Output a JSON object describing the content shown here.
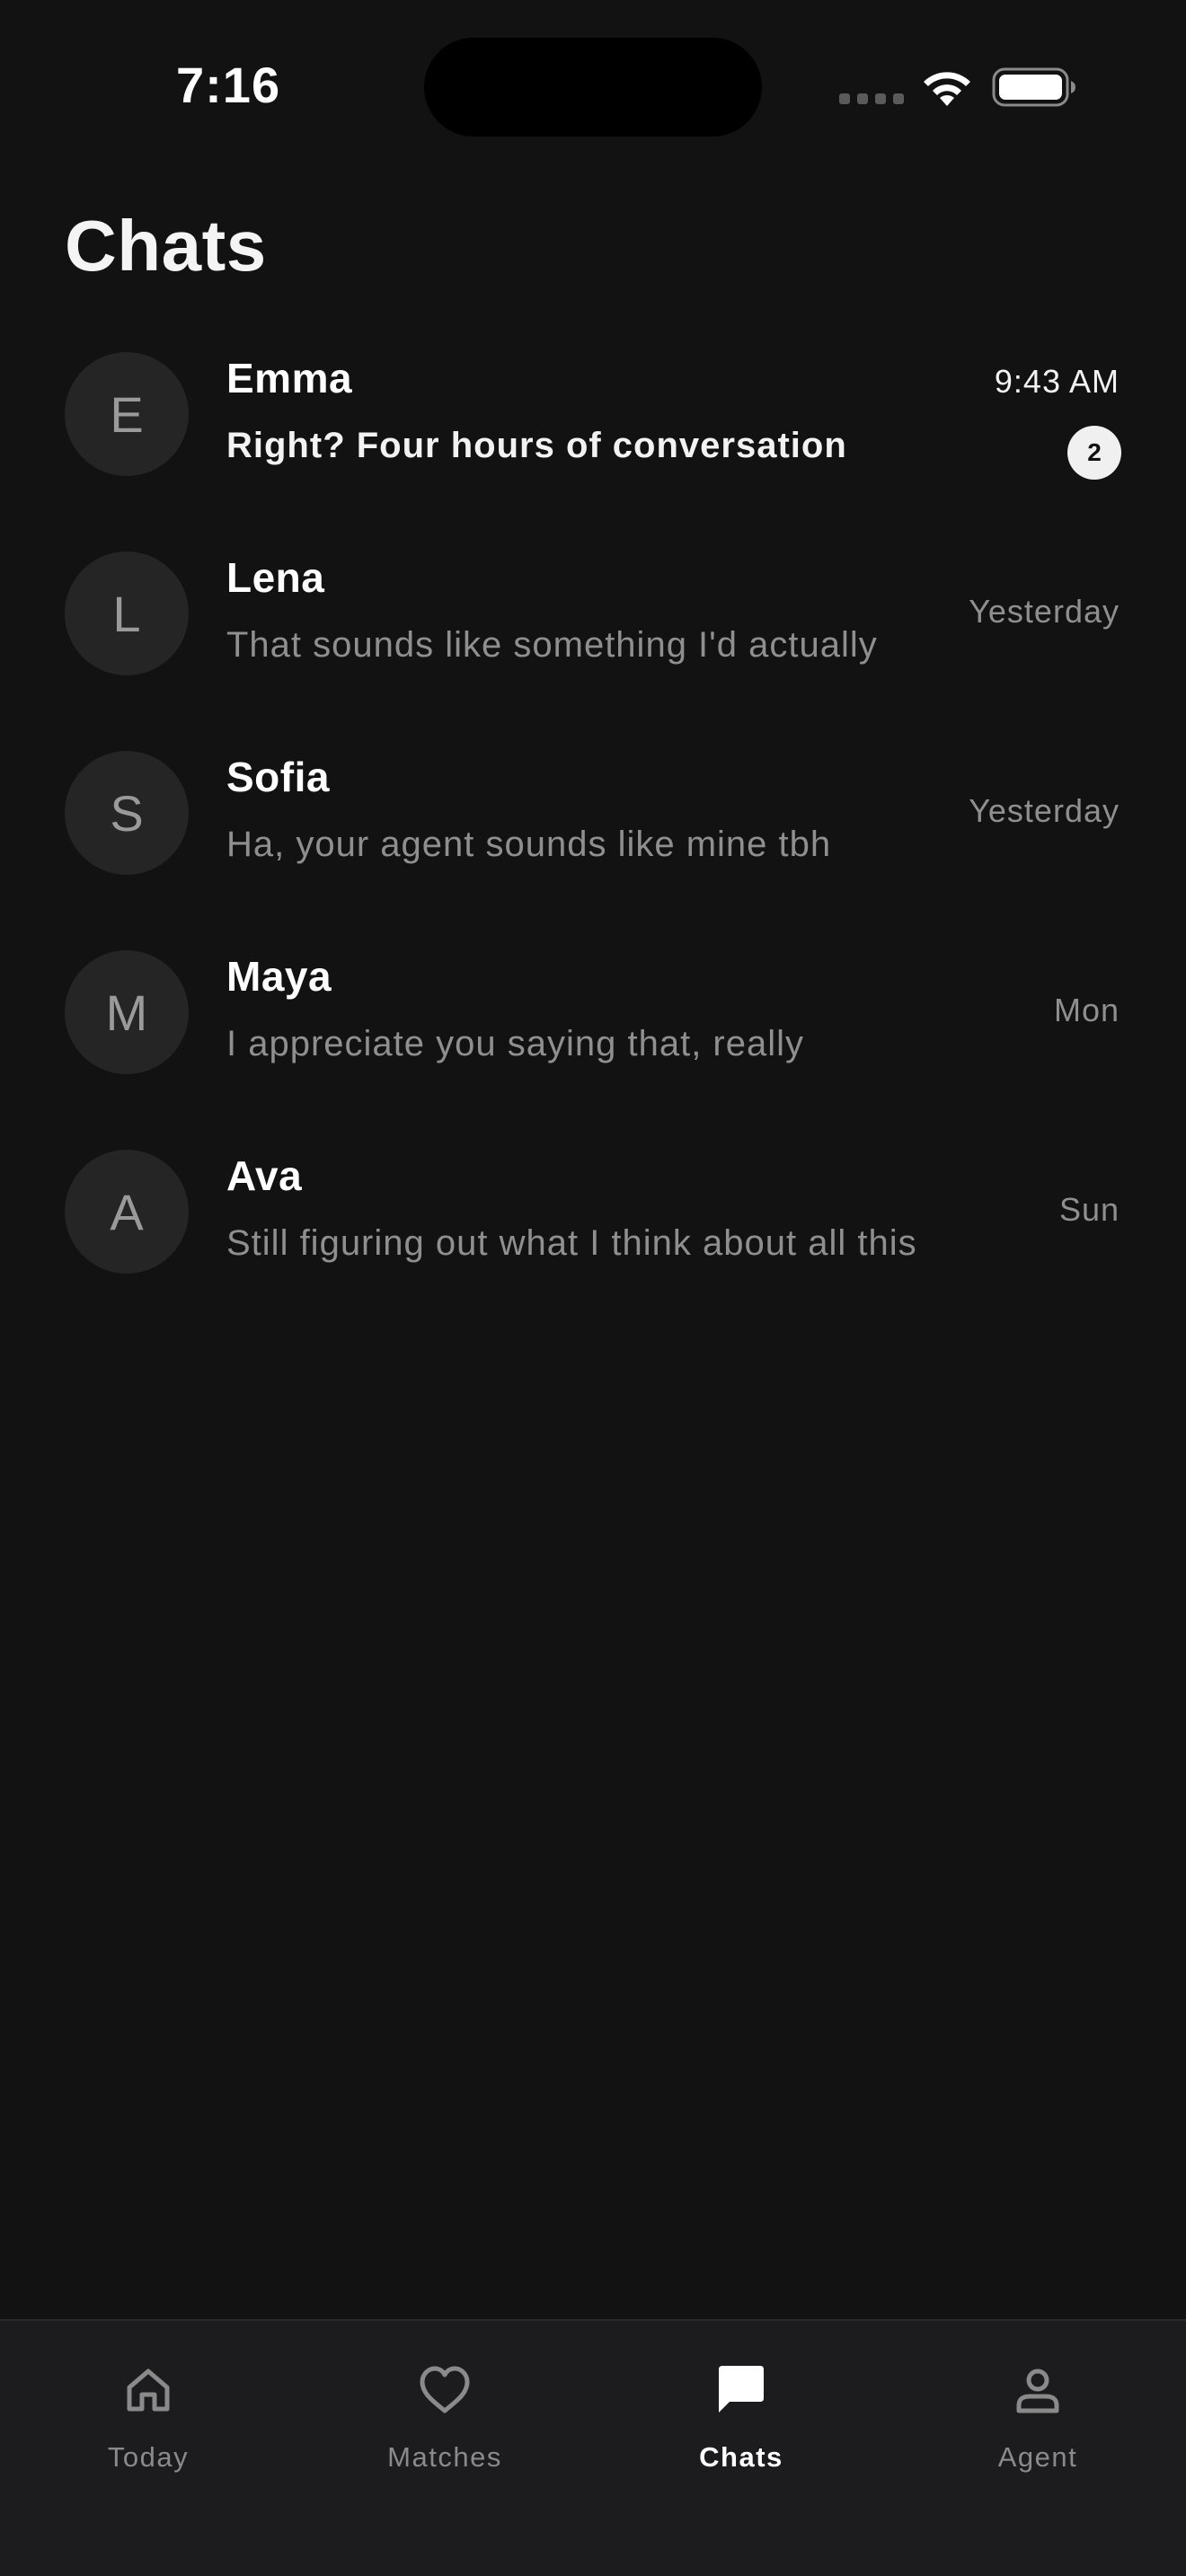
{
  "status_bar": {
    "time": "7:16",
    "icons": [
      "cellular-signal-icon",
      "wifi-icon",
      "battery-icon"
    ]
  },
  "header": {
    "title": "Chats"
  },
  "chats": [
    {
      "initial": "E",
      "name": "Emma",
      "preview": "Right? Four hours of conversation",
      "time": "9:43 AM",
      "unread_count": "2",
      "unread": true
    },
    {
      "initial": "L",
      "name": "Lena",
      "preview": "That sounds like something I'd actually",
      "time": "Yesterday",
      "unread": false
    },
    {
      "initial": "S",
      "name": "Sofia",
      "preview": "Ha, your agent sounds like mine tbh",
      "time": "Yesterday",
      "unread": false
    },
    {
      "initial": "M",
      "name": "Maya",
      "preview": "I appreciate you saying that, really",
      "time": "Mon",
      "unread": false
    },
    {
      "initial": "A",
      "name": "Ava",
      "preview": "Still figuring out what I think about all this",
      "time": "Sun",
      "unread": false
    }
  ],
  "tab_bar": {
    "tabs": [
      {
        "label": "Today",
        "icon": "home-icon",
        "active": false
      },
      {
        "label": "Matches",
        "icon": "heart-icon",
        "active": false
      },
      {
        "label": "Chats",
        "icon": "chat-bubble-icon",
        "active": true
      },
      {
        "label": "Agent",
        "icon": "person-icon",
        "active": false
      }
    ]
  },
  "colors": {
    "background": "#121212",
    "tab_bar_background": "#1c1c1e",
    "avatar_background": "#252525",
    "secondary_text": "#8f8f8f",
    "badge_background": "#f0f0f0"
  }
}
